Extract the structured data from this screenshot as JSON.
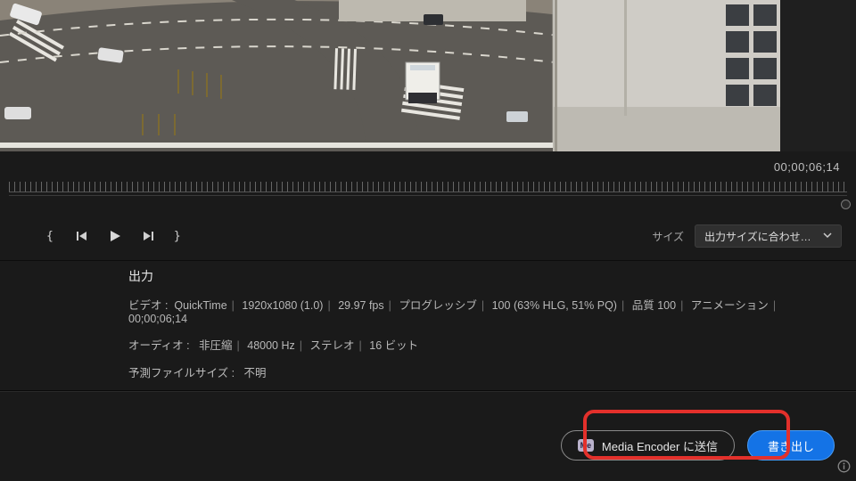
{
  "timecode": "00;00;06;14",
  "size": {
    "label": "サイズ",
    "value": "出力サイズに合わせてス…"
  },
  "output": {
    "title": "出力",
    "video": {
      "label": "ビデオ :",
      "container": "QuickTime",
      "resolution": "1920x1080 (1.0)",
      "fps": "29.97 fps",
      "scan": "プログレッシブ",
      "color": "100 (63% HLG, 51% PQ)",
      "quality_label": "品質",
      "quality_value": "100",
      "codec": "アニメーション",
      "duration": "00;00;06;14"
    },
    "audio": {
      "label": "オーディオ :",
      "compression": "非圧縮",
      "sample_rate": "48000 Hz",
      "channels": "ステレオ",
      "bit_depth": "16 ビット"
    },
    "filesize": {
      "label": "予測ファイルサイズ :",
      "value": "不明"
    }
  },
  "buttons": {
    "me_badge": "Me",
    "send_to_me": "Media Encoder に送信",
    "export": "書き出し"
  }
}
